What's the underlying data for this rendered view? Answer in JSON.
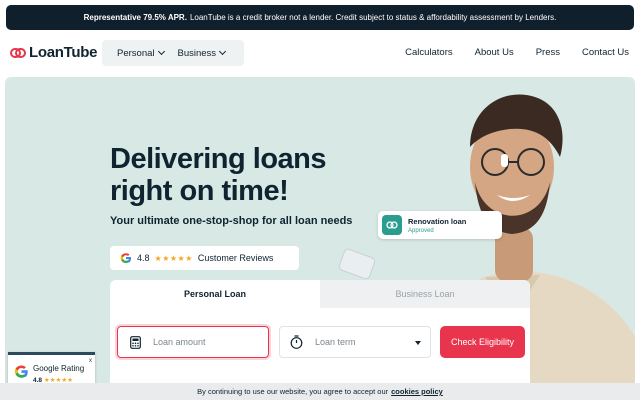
{
  "topbar": {
    "apr_bold": "Representative 79.5% APR.",
    "notice": "LoanTube is a credit broker not a lender. Credit subject to status & affordability assessment by Lenders."
  },
  "header": {
    "logo_text": "LoanTube",
    "pill": [
      {
        "label": "Personal"
      },
      {
        "label": "Business"
      }
    ],
    "nav": [
      {
        "label": "Calculators"
      },
      {
        "label": "About Us"
      },
      {
        "label": "Press"
      },
      {
        "label": "Contact Us"
      }
    ]
  },
  "hero": {
    "title_line1": "Delivering loans",
    "title_line2": "right on time!",
    "subtitle": "Your ultimate one-stop-shop for all loan needs",
    "reviews": {
      "rating": "4.8",
      "rating_value": 4.8,
      "label": "Customer Reviews"
    },
    "badge": {
      "title": "Renovation loan",
      "status": "Approved"
    }
  },
  "form": {
    "tabs": [
      {
        "label": "Personal Loan",
        "active": true
      },
      {
        "label": "Business Loan",
        "active": false
      }
    ],
    "amount_placeholder": "Loan amount",
    "term_placeholder": "Loan term",
    "cta": "Check Eligibility"
  },
  "google_rating": {
    "title": "Google Rating",
    "score": "4.8",
    "close": "x"
  },
  "cookie": {
    "text": "By continuing to use our website, you agree to accept our",
    "link": "cookies policy"
  },
  "colors": {
    "brand_red": "#e8344c",
    "navy": "#0f1f2c",
    "hero_bg": "#d8e8e4",
    "teal": "#2a9d8f"
  },
  "icons": [
    "loantube-logo-icon",
    "chevron-down-icon",
    "google-g-icon",
    "star-icon",
    "link-icon",
    "calculator-icon",
    "stopwatch-icon",
    "caret-down-icon"
  ]
}
